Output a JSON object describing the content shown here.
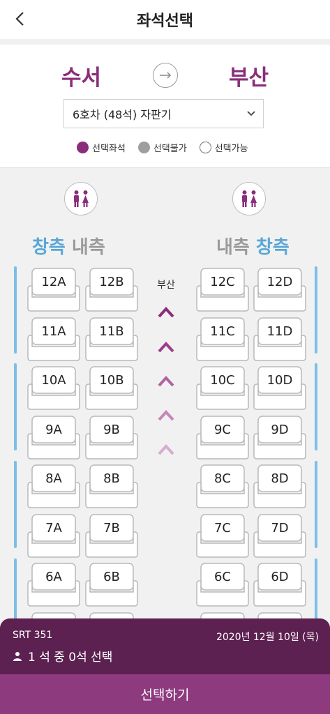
{
  "header": {
    "title": "좌석선택",
    "back_icon": "chevron-left-icon"
  },
  "route": {
    "departure": "수서",
    "arrival": "부산",
    "arrow_icon": "arrow-right-icon"
  },
  "car_select": {
    "value": "6호차 (48석) 자판기",
    "icon": "chevron-down-icon"
  },
  "legend": [
    {
      "label": "선택좌석",
      "color": "#8a2d7a"
    },
    {
      "label": "선택불가",
      "color": "#9e9e9e"
    },
    {
      "label": "선택가능",
      "color": "#ffffff"
    }
  ],
  "seatmap": {
    "left_labels": {
      "window": "창측",
      "aisle": "내측"
    },
    "right_labels": {
      "aisle": "내측",
      "window": "창측"
    },
    "direction": "부산",
    "restroom_icon": "restroom-icon",
    "rows": [
      {
        "row": "12",
        "seats": [
          "12A",
          "12B",
          "12C",
          "12D"
        ]
      },
      {
        "row": "11",
        "seats": [
          "11A",
          "11B",
          "11C",
          "11D"
        ]
      },
      {
        "row": "10",
        "seats": [
          "10A",
          "10B",
          "10C",
          "10D"
        ]
      },
      {
        "row": "9",
        "seats": [
          "9A",
          "9B",
          "9C",
          "9D"
        ]
      },
      {
        "row": "8",
        "seats": [
          "8A",
          "8B",
          "8C",
          "8D"
        ]
      },
      {
        "row": "7",
        "seats": [
          "7A",
          "7B",
          "7C",
          "7D"
        ]
      },
      {
        "row": "6",
        "seats": [
          "6A",
          "6B",
          "6C",
          "6D"
        ]
      }
    ],
    "colors": {
      "window_bar": "#7bbfe6",
      "accent": "#8a2d7a"
    }
  },
  "summary": {
    "train": "SRT 351",
    "date": "2020년 12월 10일 (목)",
    "count": "1 석 중 0석 선택",
    "person_icon": "person-icon"
  },
  "confirm_label": "선택하기"
}
